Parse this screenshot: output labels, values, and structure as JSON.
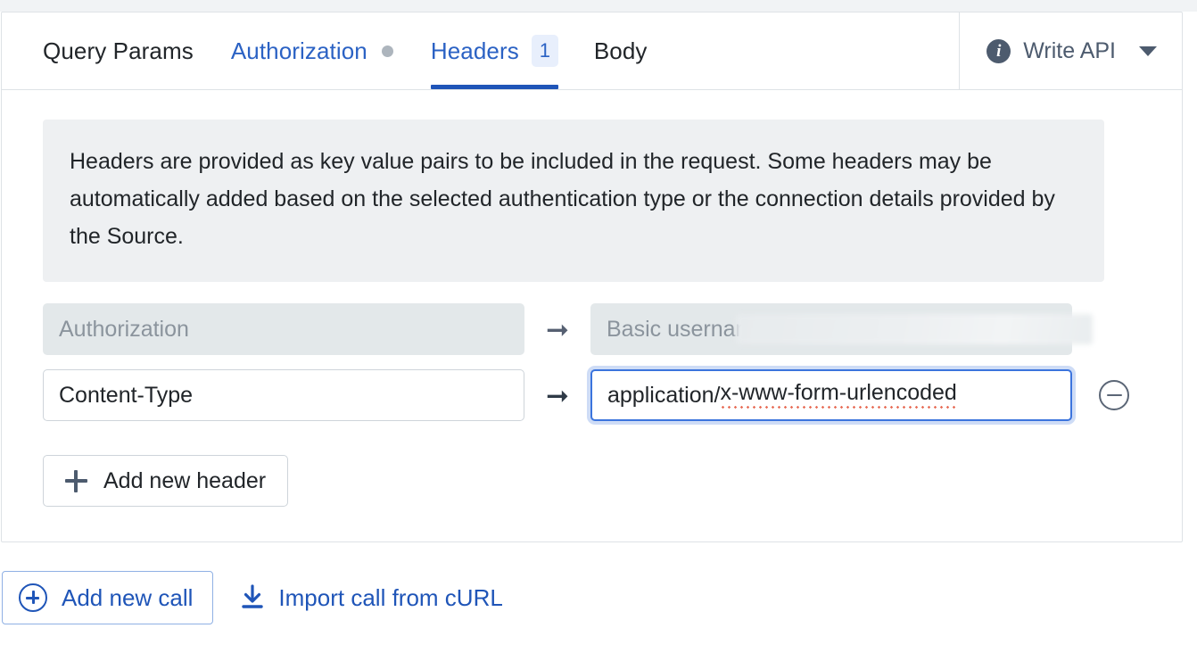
{
  "tabs": [
    {
      "label": "Query Params",
      "state": "default",
      "indicator": "none"
    },
    {
      "label": "Authorization",
      "state": "link",
      "indicator": "dot"
    },
    {
      "label": "Headers",
      "state": "active",
      "indicator": "badge",
      "badge": "1"
    },
    {
      "label": "Body",
      "state": "default",
      "indicator": "none"
    }
  ],
  "api_selector": {
    "label": "Write API",
    "info_glyph": "i",
    "caret_icon": "chevron-down-icon"
  },
  "notice": {
    "text": "Headers are provided as key value pairs to be included in the request. Some headers may be automatically added based on the selected authentication type or the connection details provided by the Source."
  },
  "headers": [
    {
      "key_value": "",
      "key_placeholder": "Authorization",
      "value_text": "Basic username:",
      "value_redacted": true,
      "disabled": true,
      "removable": false,
      "arrow_icon": "arrow-right-icon"
    },
    {
      "key_value": "Content-Type",
      "key_placeholder": "",
      "value_text": "application/x-www-form-urlencoded",
      "value_spellcheck_part": "x-www-form-urlencoded",
      "value_prefix": "application/",
      "value_redacted": false,
      "disabled": false,
      "focused": true,
      "removable": true,
      "arrow_icon": "arrow-right-icon",
      "remove_icon": "circle-minus-icon"
    }
  ],
  "add_header_button": {
    "label": "Add new header",
    "icon": "plus-icon"
  },
  "footer": {
    "add_call": {
      "label": "Add new call",
      "icon": "circle-plus-icon"
    },
    "import_curl": {
      "label": "Import call from cURL",
      "icon": "download-icon"
    }
  },
  "colors": {
    "accent_blue": "#1f55b8",
    "link_blue": "#2b62c4",
    "badge_bg": "#e8effc",
    "notice_bg": "#eef0f2",
    "disabled_field_bg": "#e3e8ea",
    "focus_border": "#3b74dd",
    "spellcheck_red": "#e8705a",
    "muted_dot": "#adb5bd"
  }
}
